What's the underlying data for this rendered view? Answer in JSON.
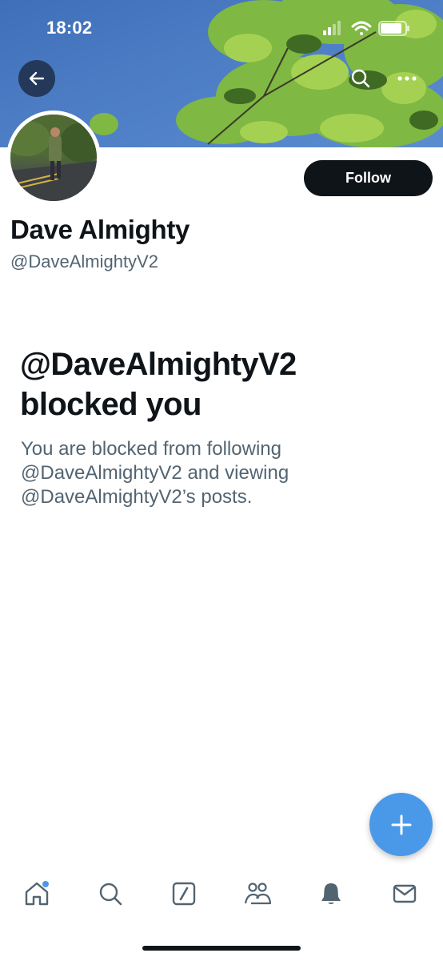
{
  "status_bar": {
    "time": "18:02",
    "icons": [
      "cellular-signal-icon",
      "wifi-icon",
      "battery-icon"
    ]
  },
  "header": {
    "back_icon": "arrow-left-icon",
    "search_icon": "search-icon",
    "more_icon": "more-horizontal-icon"
  },
  "profile": {
    "display_name": "Dave Almighty",
    "handle": "@DaveAlmightyV2",
    "follow_label": "Follow"
  },
  "blocked": {
    "title_line1": "@DaveAlmightyV2",
    "title_line2": "blocked you",
    "description_line1": "You are blocked from following",
    "description_line2": "@DaveAlmightyV2 and viewing",
    "description_line3": "@DaveAlmightyV2’s posts."
  },
  "fab": {
    "icon": "plus-icon"
  },
  "bottom_nav": {
    "items": [
      {
        "icon": "home-icon",
        "has_notification_dot": true
      },
      {
        "icon": "search-icon"
      },
      {
        "icon": "grok-slash-icon"
      },
      {
        "icon": "communities-icon"
      },
      {
        "icon": "bell-icon"
      },
      {
        "icon": "mail-icon"
      }
    ]
  },
  "colors": {
    "accent": "#4a99e9",
    "text_primary": "#0f1419",
    "text_secondary": "#536471",
    "follow_bg": "#0f1419"
  }
}
